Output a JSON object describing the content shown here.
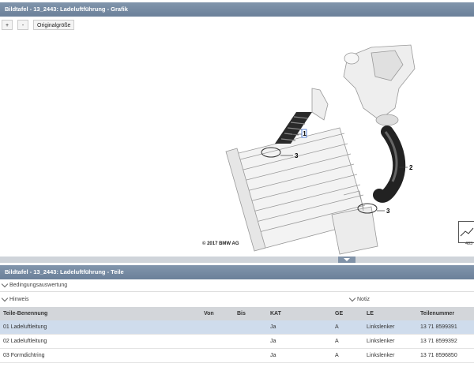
{
  "graphic_panel": {
    "title": "Bildtafel - 13_2443: Ladeluftführung - Grafik",
    "toolbar": {
      "zoom_in": "+",
      "zoom_out": "-",
      "original_size": "Originalgröße"
    },
    "copyright": "© 2017 BMW AG",
    "callouts": [
      "1",
      "2",
      "3",
      "3"
    ],
    "thumbnail_number": "483"
  },
  "parts_panel": {
    "title": "Bildtafel - 13_2443: Ladeluftführung - Teile",
    "condition_label": "Bedingungsauswertung",
    "hint_label": "Hinweis",
    "note_label": "Notiz",
    "columns": [
      "Teile-Benennung",
      "Von",
      "Bis",
      "KAT",
      "GE",
      "LE",
      "Teilenummer"
    ],
    "rows": [
      {
        "name": "01 Ladeluftleitung",
        "von": "",
        "bis": "",
        "kat": "Ja",
        "ge": "A",
        "le": "Linkslenker",
        "part": "13 71 8599391",
        "selected": true
      },
      {
        "name": "02 Ladeluftleitung",
        "von": "",
        "bis": "",
        "kat": "Ja",
        "ge": "A",
        "le": "Linkslenker",
        "part": "13 71 8599392",
        "selected": false
      },
      {
        "name": "03 Formdichtring",
        "von": "",
        "bis": "",
        "kat": "Ja",
        "ge": "A",
        "le": "Linkslenker",
        "part": "13 71 8596850",
        "selected": false
      }
    ]
  },
  "colors": {
    "header": "#7488a2",
    "selected_row": "#cfdcec",
    "table_header": "#d3d6da"
  }
}
